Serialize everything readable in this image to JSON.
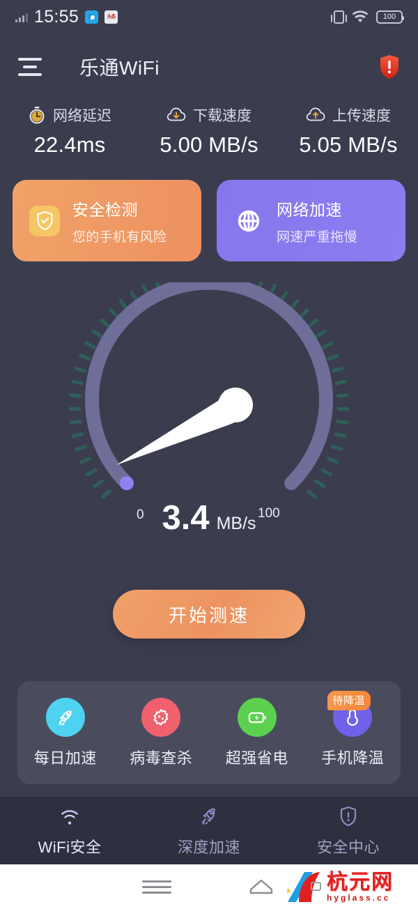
{
  "statusbar": {
    "time": "15:55",
    "battery": "100",
    "app_icon_1": "browser-icon",
    "app_icon_2": "news-app-icon",
    "signal_icon": "signal-bars-icon",
    "vibrate_icon": "vibrate-icon",
    "wifi_icon": "wifi-icon"
  },
  "appbar": {
    "menu_icon": "hamburger-menu-icon",
    "title": "乐通WiFi",
    "warning_icon": "shield-warning-icon"
  },
  "stats": [
    {
      "icon": "stopwatch-icon",
      "label": "网络延迟",
      "value": "22.4ms"
    },
    {
      "icon": "cloud-download-icon",
      "label": "下载速度",
      "value": "5.00 MB/s"
    },
    {
      "icon": "cloud-upload-icon",
      "label": "上传速度",
      "value": "5.05 MB/s"
    }
  ],
  "cards": [
    {
      "icon": "shield-check-icon",
      "title": "安全检测",
      "subtitle": "您的手机有风险",
      "color": "#ee9a63"
    },
    {
      "icon": "globe-icon",
      "title": "网络加速",
      "subtitle": "网速严重拖慢",
      "color": "#8878ee"
    }
  ],
  "gauge": {
    "value": "3.4",
    "unit": "MB/s",
    "min_label": "0",
    "max_label": "100",
    "arc_color": "#6f6e99",
    "tick_color": "#2f5f58",
    "cap_color": "#8d83f0",
    "needle_color": "#ffffff"
  },
  "start_button": {
    "label": "开始测速"
  },
  "quick_actions": [
    {
      "icon": "rocket-icon",
      "label": "每日加速",
      "color": "#4fd2ef",
      "badge": ""
    },
    {
      "icon": "virus-icon",
      "label": "病毒查杀",
      "color": "#f0606d",
      "badge": ""
    },
    {
      "icon": "battery-bolt-icon",
      "label": "超强省电",
      "color": "#5bd14f",
      "badge": ""
    },
    {
      "icon": "thermometer-icon",
      "label": "手机降温",
      "color": "#6f61e8",
      "badge": "待降温"
    }
  ],
  "bottom_nav": [
    {
      "icon": "wifi-icon",
      "label": "WiFi安全",
      "active": true
    },
    {
      "icon": "rocket-outline-icon",
      "label": "深度加速",
      "active": false
    },
    {
      "icon": "shield-alert-icon",
      "label": "安全中心",
      "active": false
    }
  ],
  "android_nav": {
    "menu_icon": "android-menu-icon",
    "home_icon": "android-home-icon"
  },
  "watermark": {
    "text": "杭元网",
    "domain": "hyglass.cc"
  }
}
